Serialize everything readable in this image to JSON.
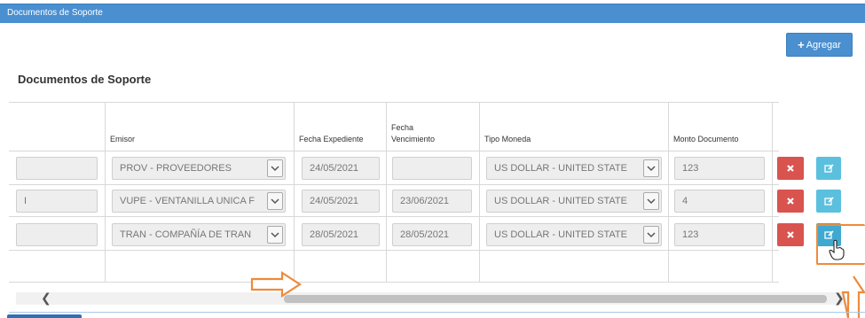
{
  "panel": {
    "title": "Documentos de Soporte"
  },
  "toolbar": {
    "add_label": "Agregar"
  },
  "section": {
    "title": "Documentos de Soporte"
  },
  "columns": {
    "emisor": "Emisor",
    "fecha_expediente": "Fecha Expediente",
    "fecha_vencimiento": "Fecha Vencimiento",
    "tipo_moneda": "Tipo Moneda",
    "monto_documento": "Monto Documento"
  },
  "rows": [
    {
      "first": "",
      "emisor": "PROV - PROVEEDORES",
      "fecha_expediente": "24/05/2021",
      "fecha_vencimiento": "",
      "tipo_moneda": "US DOLLAR - UNITED STATE",
      "monto": "123"
    },
    {
      "first": "I",
      "emisor": "VUPE - VENTANILLA UNICA F",
      "fecha_expediente": "24/05/2021",
      "fecha_vencimiento": "23/06/2021",
      "tipo_moneda": "US DOLLAR - UNITED STATE",
      "monto": "4"
    },
    {
      "first": "",
      "emisor": "TRAN - COMPAÑÍA DE TRAN",
      "fecha_expediente": "28/05/2021",
      "fecha_vencimiento": "28/05/2021",
      "tipo_moneda": "US DOLLAR - UNITED STATE",
      "monto": "123"
    }
  ],
  "icons": {
    "add": "plus-icon",
    "select": "chevron-down-icon",
    "delete": "close-icon",
    "edit": "edit-icon",
    "cursor": "hand-pointer-icon",
    "scroll_left": "chevron-left-icon",
    "scroll_right": "chevron-right-icon",
    "annotation": "arrow-annotation-icon"
  },
  "colors": {
    "header": "#4a8fd0",
    "primary_button": "#4a8fd0",
    "danger": "#d9534f",
    "info": "#5bc0de",
    "annotation": "#ef8a3a"
  }
}
